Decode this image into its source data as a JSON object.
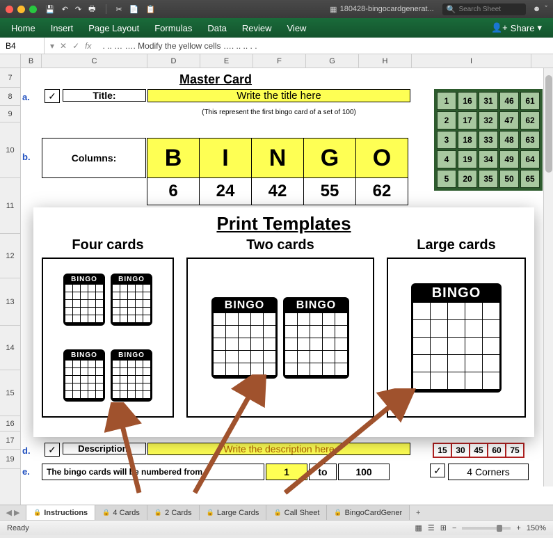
{
  "title": {
    "filename": "180428-bingocardgenerat...",
    "search_ph": "Search Sheet"
  },
  "menu": {
    "items": [
      "Home",
      "Insert",
      "Page Layout",
      "Formulas",
      "Data",
      "Review",
      "View"
    ],
    "share": "Share"
  },
  "fx": {
    "cell": "B4",
    "formula": ". .. … …. Modify the yellow cells …. .. .. . ."
  },
  "cols": [
    "B",
    "C",
    "D",
    "E",
    "F",
    "G",
    "H",
    "I"
  ],
  "rows": [
    "7",
    "8",
    "9",
    "10",
    "11",
    "12",
    "13",
    "14",
    "15",
    "16",
    "17",
    "19"
  ],
  "master": {
    "heading": "Master Card",
    "a": "a.",
    "title_lbl": "Title:",
    "title_val": "Write the title here",
    "note": "(This represent the first bingo card of a set of 100)",
    "b": "b.",
    "cols_lbl": "Columns:",
    "letters": [
      "B",
      "I",
      "N",
      "G",
      "O"
    ],
    "nums": [
      "6",
      "24",
      "42",
      "55",
      "62"
    ]
  },
  "call": [
    "1",
    "16",
    "31",
    "46",
    "61",
    "2",
    "17",
    "32",
    "47",
    "62",
    "3",
    "18",
    "33",
    "48",
    "63",
    "4",
    "19",
    "34",
    "49",
    "64",
    "5",
    "20",
    "35",
    "50",
    "65"
  ],
  "overlay": {
    "heading": "Print Templates",
    "t1": "Four cards",
    "t2": "Two cards",
    "t3": "Large cards",
    "bingo": "BINGO"
  },
  "desc": {
    "d": "d.",
    "lbl": "Description:",
    "val": "Write the description here",
    "nums": [
      "15",
      "30",
      "45",
      "60",
      "75"
    ]
  },
  "num": {
    "e": "e.",
    "text1": "The bingo cards will be numbered from",
    "from": "1",
    "to_lbl": "to",
    "to": "100",
    "corners": "4 Corners"
  },
  "tabs": [
    "Instructions",
    "4 Cards",
    "2 Cards",
    "Large Cards",
    "Call Sheet",
    "BingoCardGener"
  ],
  "status": {
    "ready": "Ready",
    "zoom": "150%"
  }
}
